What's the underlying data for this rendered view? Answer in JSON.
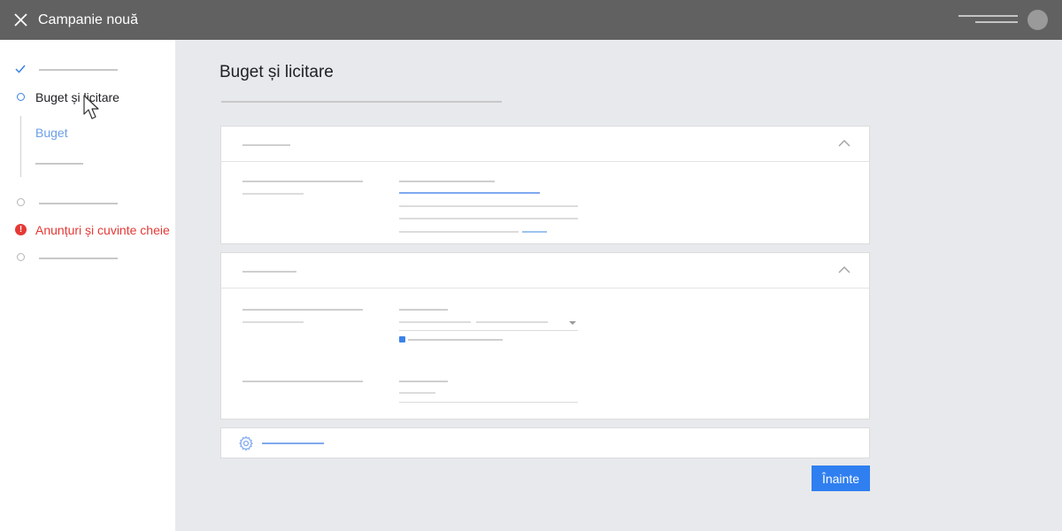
{
  "header": {
    "title": "Campanie nouă",
    "close_icon": "close-icon",
    "bg_color": "#616161"
  },
  "sidebar": {
    "steps": [
      {
        "state": "done",
        "icon": "check-icon",
        "label": ""
      },
      {
        "state": "current",
        "icon": "ring-icon",
        "label": "Buget și licitare"
      },
      {
        "state": "pending",
        "icon": "ring-icon",
        "label": ""
      },
      {
        "state": "error",
        "icon": "error-icon",
        "label": "Anunțuri și cuvinte cheie"
      },
      {
        "state": "pending",
        "icon": "ring-icon",
        "label": ""
      }
    ],
    "substeps": [
      {
        "label": "Buget",
        "active": true
      },
      {
        "label": ""
      }
    ],
    "error_color": "#e53935",
    "accent_color": "#3b82e8"
  },
  "main": {
    "page_title": "Buget și licitare",
    "settings_icon": "gear-icon",
    "next_button": "Înainte"
  },
  "colors": {
    "primary_button": "#2f7ff0",
    "background": "#e8e9ec"
  }
}
